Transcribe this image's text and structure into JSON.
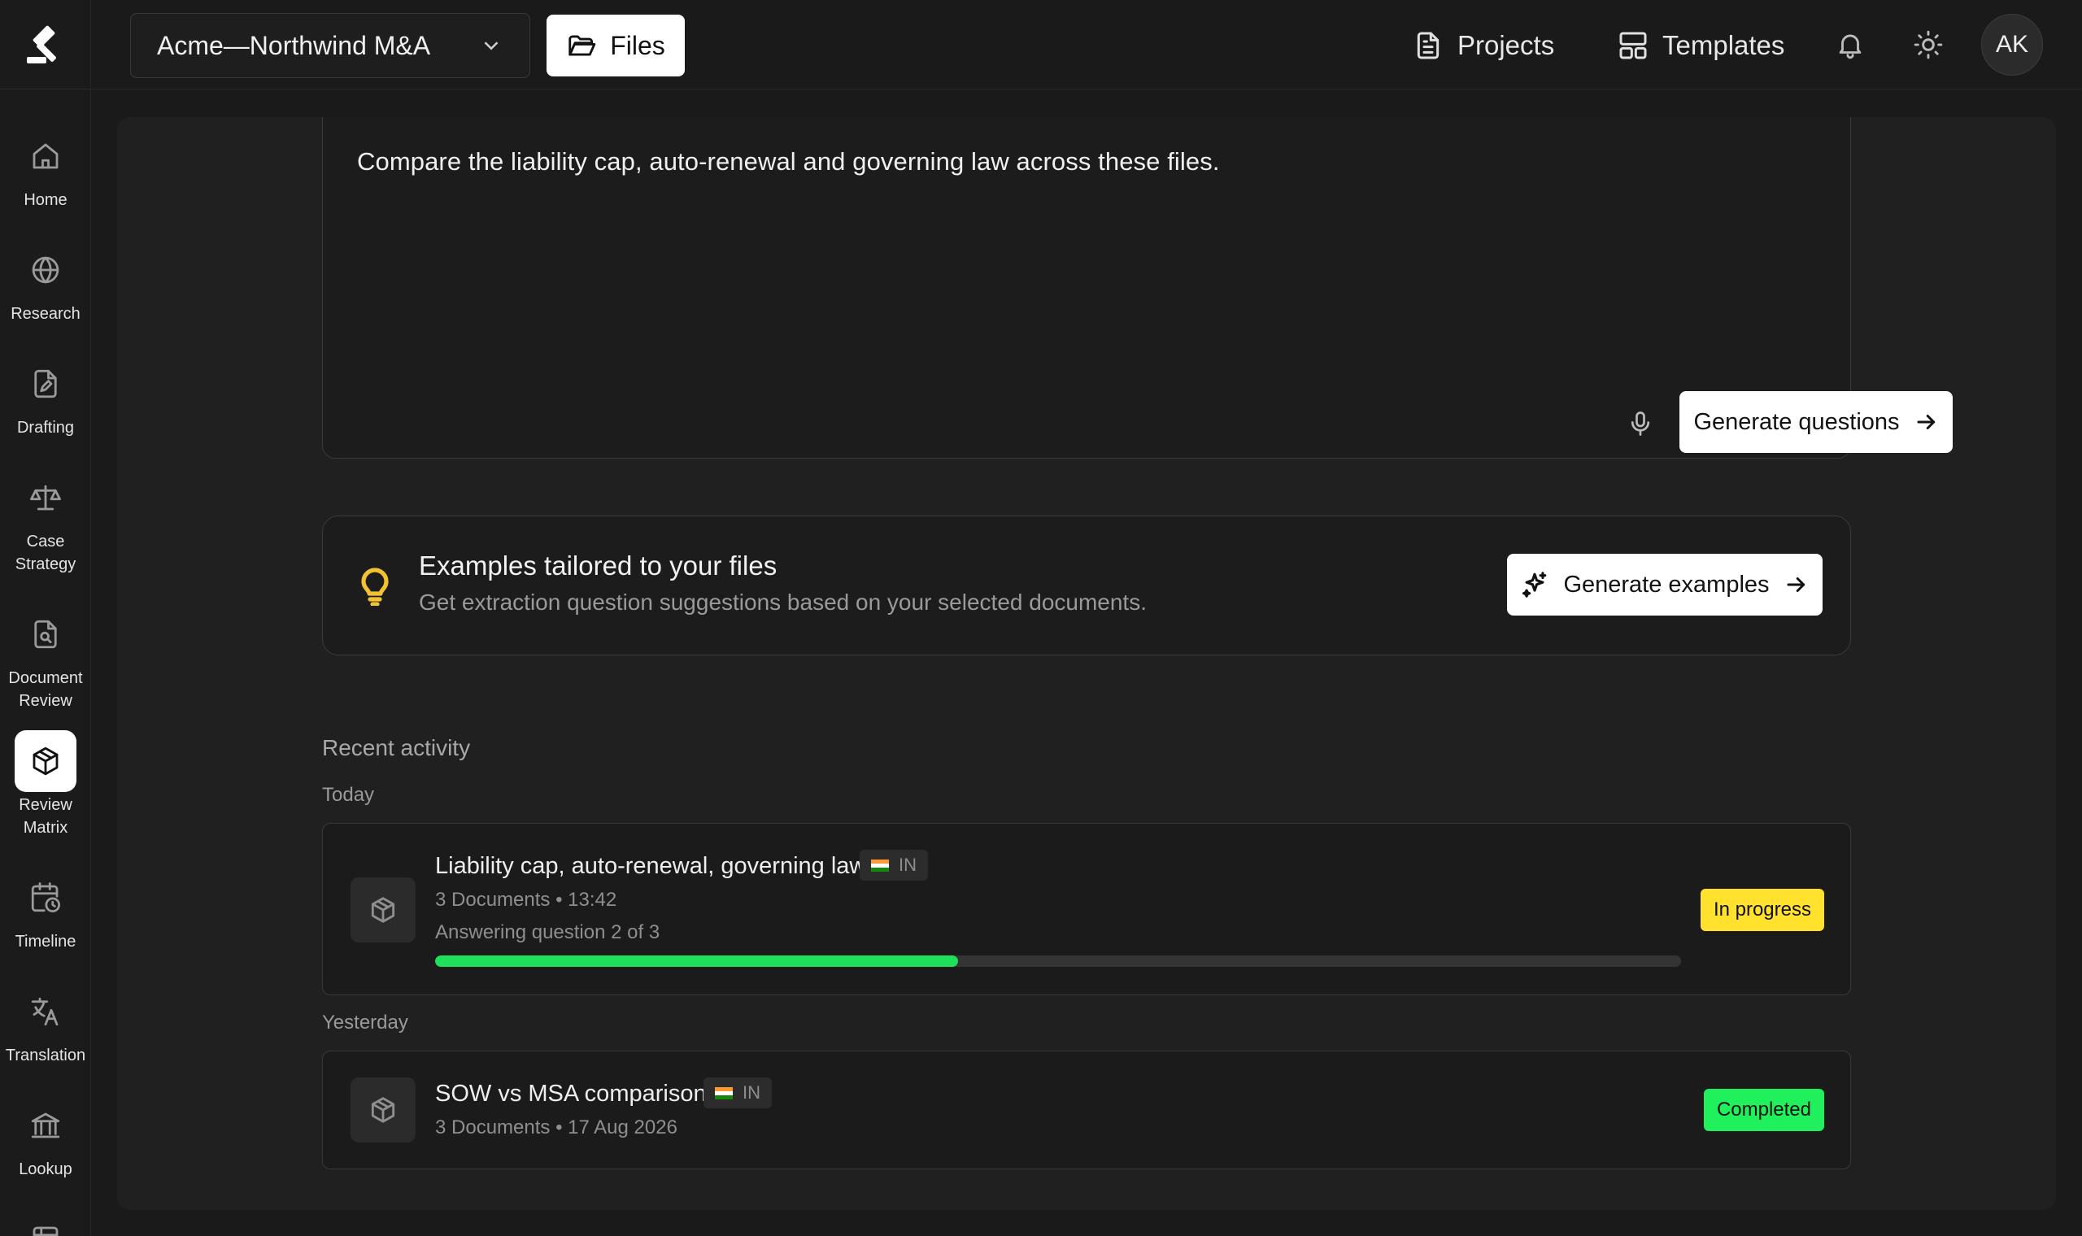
{
  "app": {
    "project_selector": "Acme—Northwind M&A",
    "files_label": "Files"
  },
  "sidebar": {
    "items": [
      {
        "label": "Home",
        "icon": "home-icon"
      },
      {
        "label": "Research",
        "icon": "globe-icon"
      },
      {
        "label": "Drafting",
        "icon": "pen-document-icon"
      },
      {
        "label": "Case\nStrategy",
        "icon": "scales-icon"
      },
      {
        "label": "Document\nReview",
        "icon": "document-search-icon"
      },
      {
        "label": "Review\nMatrix",
        "icon": "cube-icon",
        "active": true
      },
      {
        "label": "Timeline",
        "icon": "calendar-clock-icon"
      },
      {
        "label": "Translation",
        "icon": "translate-icon"
      },
      {
        "label": "Lookup",
        "icon": "bank-icon"
      }
    ]
  },
  "header": {
    "projects_label": "Projects",
    "templates_label": "Templates",
    "avatar_initials": "AK"
  },
  "prompt": {
    "text": "Compare the liability cap, auto-renewal and governing law across these files.",
    "generate_label": "Generate questions"
  },
  "examples": {
    "title": "Examples tailored to your files",
    "subtitle": "Get extraction question suggestions based on your selected documents.",
    "button_label": "Generate examples"
  },
  "recent": {
    "title": "Recent activity",
    "groups": [
      {
        "label": "Today",
        "items": [
          {
            "title": "Liability cap, auto-renewal, governing law",
            "jurisdiction": "IN",
            "meta": "3 Documents • 13:42",
            "detail": "Answering question 2 of 3",
            "progress": 0.42,
            "status": "In progress",
            "status_color": "#ffe12e"
          }
        ]
      },
      {
        "label": "Yesterday",
        "items": [
          {
            "title": "SOW vs MSA comparison",
            "jurisdiction": "IN",
            "meta": "3 Documents • 17 Aug 2026",
            "status": "Completed",
            "status_color": "#1ff05c"
          }
        ]
      }
    ]
  },
  "colors": {
    "accent_progress": "#1fe05a",
    "status_in_progress": "#ffe12e",
    "status_completed": "#1ff05c",
    "bulb": "#f2c230"
  }
}
